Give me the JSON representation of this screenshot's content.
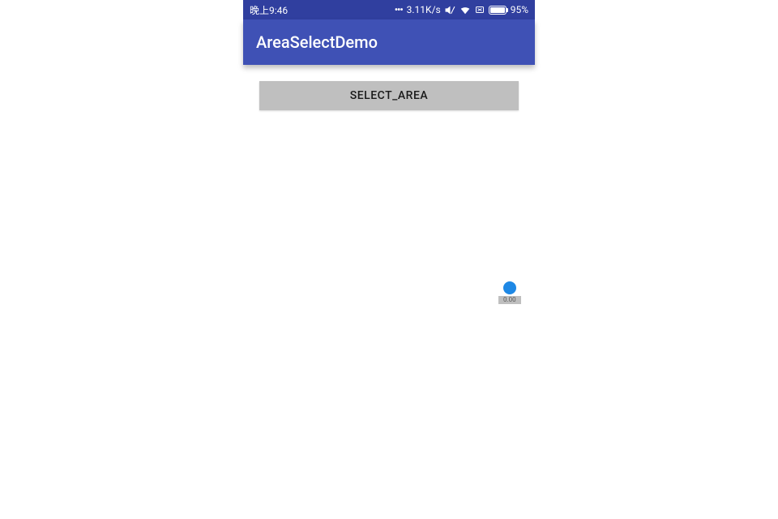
{
  "status_bar": {
    "time": "晚上9:46",
    "net_speed": "3.11K/s",
    "battery_percent": "95%"
  },
  "app_bar": {
    "title": "AreaSelectDemo"
  },
  "main": {
    "select_button_label": "SELECT_AREA"
  },
  "floating": {
    "label": "0.00"
  }
}
